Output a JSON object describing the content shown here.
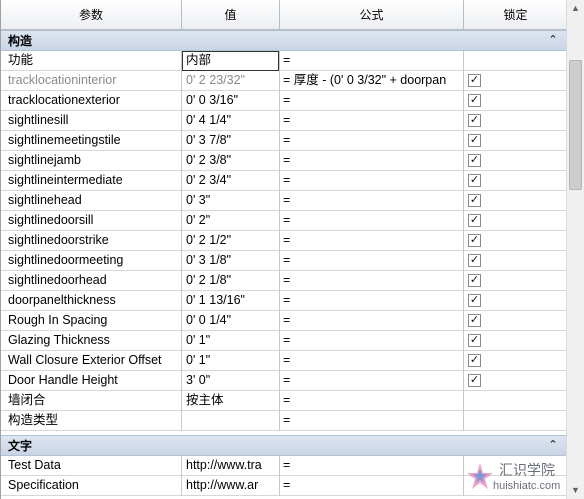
{
  "header": {
    "param": "参数",
    "value": "值",
    "formula": "公式",
    "lock": "锁定"
  },
  "groups": [
    {
      "label": "构造",
      "toggle": "≈"
    },
    {
      "label": "文字",
      "toggle": "≈"
    }
  ],
  "construction_rows": [
    {
      "param": "功能",
      "value": "内部",
      "formula": "=",
      "locked": false,
      "disabled": false,
      "selected": true
    },
    {
      "param": "tracklocationinterior",
      "value": "0'  2 23/32\"",
      "formula": "= 厚度 - (0'  0 3/32\" + doorpan",
      "locked": true,
      "disabled": true
    },
    {
      "param": "tracklocationexterior",
      "value": "0'  0 3/16\"",
      "formula": "=",
      "locked": true
    },
    {
      "param": "sightlinesill",
      "value": "0'  4 1/4\"",
      "formula": "=",
      "locked": true
    },
    {
      "param": "sightlinemeetingstile",
      "value": "0'  3 7/8\"",
      "formula": "=",
      "locked": true
    },
    {
      "param": "sightlinejamb",
      "value": "0'  2 3/8\"",
      "formula": "=",
      "locked": true
    },
    {
      "param": "sightlineintermediate",
      "value": "0'  2 3/4\"",
      "formula": "=",
      "locked": true
    },
    {
      "param": "sightlinehead",
      "value": "0'  3\"",
      "formula": "=",
      "locked": true
    },
    {
      "param": "sightlinedoorsill",
      "value": "0'  2\"",
      "formula": "=",
      "locked": true
    },
    {
      "param": "sightlinedoorstrike",
      "value": "0'  2 1/2\"",
      "formula": "=",
      "locked": true
    },
    {
      "param": "sightlinedoormeeting",
      "value": "0'  3 1/8\"",
      "formula": "=",
      "locked": true
    },
    {
      "param": "sightlinedoorhead",
      "value": "0'  2 1/8\"",
      "formula": "=",
      "locked": true
    },
    {
      "param": "doorpanelthickness",
      "value": "0'  1 13/16\"",
      "formula": "=",
      "locked": true
    },
    {
      "param": "Rough In Spacing",
      "value": "0'  0 1/4\"",
      "formula": "=",
      "locked": true
    },
    {
      "param": "Glazing Thickness",
      "value": "0'  1\"",
      "formula": "=",
      "locked": true
    },
    {
      "param": "Wall Closure Exterior Offset",
      "value": "0'  1\"",
      "formula": "=",
      "locked": true
    },
    {
      "param": "Door Handle Height",
      "value": "3'  0\"",
      "formula": "=",
      "locked": true
    },
    {
      "param": "墙闭合",
      "value": "按主体",
      "formula": "=",
      "locked": false
    },
    {
      "param": "构造类型",
      "value": "",
      "formula": "=",
      "locked": false
    }
  ],
  "text_rows": [
    {
      "param": "Test Data",
      "value": "http://www.tra",
      "formula": "=",
      "locked": false
    },
    {
      "param": "Specification",
      "value": "http://www.ar",
      "formula": "=",
      "locked": false
    }
  ],
  "watermark": {
    "text": "汇识学院",
    "url": "huishiatc.com"
  },
  "colors": {
    "group_bg": "#d3dceb",
    "header_bg": "#eceef2",
    "border": "#c8c8c8"
  },
  "icons": {
    "lock_checked": "checkbox-checked-icon",
    "collapse": "collapse-chevron-icon"
  }
}
